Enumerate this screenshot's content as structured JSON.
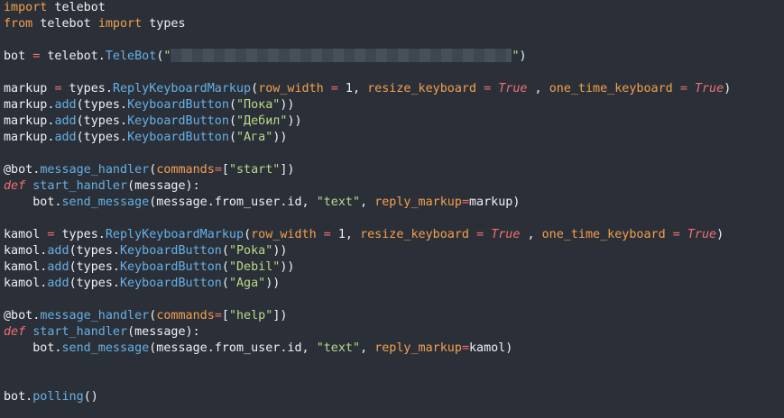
{
  "lines": [
    {
      "tokens": [
        {
          "t": "import",
          "c": "kw"
        },
        {
          "t": " telebot",
          "c": "mod"
        }
      ]
    },
    {
      "tokens": [
        {
          "t": "from",
          "c": "kw"
        },
        {
          "t": " telebot ",
          "c": "mod"
        },
        {
          "t": "import",
          "c": "kw"
        },
        {
          "t": " types",
          "c": "mod"
        }
      ]
    },
    {
      "tokens": []
    },
    {
      "tokens": [
        {
          "t": "bot ",
          "c": "mod"
        },
        {
          "t": "=",
          "c": "op"
        },
        {
          "t": " telebot.",
          "c": "mod"
        },
        {
          "t": "TeleBot",
          "c": "call"
        },
        {
          "t": "(",
          "c": "mod"
        },
        {
          "t": "\"",
          "c": "str"
        },
        {
          "t": "",
          "c": "redacted"
        },
        {
          "t": "\"",
          "c": "str"
        },
        {
          "t": ")",
          "c": "mod"
        }
      ]
    },
    {
      "tokens": []
    },
    {
      "tokens": [
        {
          "t": "markup ",
          "c": "mod"
        },
        {
          "t": "=",
          "c": "op"
        },
        {
          "t": " types.",
          "c": "mod"
        },
        {
          "t": "ReplyKeyboardMarkup",
          "c": "call"
        },
        {
          "t": "(",
          "c": "mod"
        },
        {
          "t": "row_width",
          "c": "param"
        },
        {
          "t": " ",
          "c": "mod"
        },
        {
          "t": "=",
          "c": "op"
        },
        {
          "t": " 1, ",
          "c": "mod"
        },
        {
          "t": "resize_keyboard",
          "c": "param"
        },
        {
          "t": " ",
          "c": "mod"
        },
        {
          "t": "=",
          "c": "op"
        },
        {
          "t": " ",
          "c": "mod"
        },
        {
          "t": "True",
          "c": "bool"
        },
        {
          "t": " , ",
          "c": "mod"
        },
        {
          "t": "one_time_keyboard",
          "c": "param"
        },
        {
          "t": " ",
          "c": "mod"
        },
        {
          "t": "=",
          "c": "op"
        },
        {
          "t": " ",
          "c": "mod"
        },
        {
          "t": "True",
          "c": "bool"
        },
        {
          "t": ")",
          "c": "mod"
        }
      ]
    },
    {
      "tokens": [
        {
          "t": "markup.",
          "c": "mod"
        },
        {
          "t": "add",
          "c": "call"
        },
        {
          "t": "(types.",
          "c": "mod"
        },
        {
          "t": "KeyboardButton",
          "c": "call"
        },
        {
          "t": "(",
          "c": "mod"
        },
        {
          "t": "\"Пока\"",
          "c": "str"
        },
        {
          "t": "))",
          "c": "mod"
        }
      ]
    },
    {
      "tokens": [
        {
          "t": "markup.",
          "c": "mod"
        },
        {
          "t": "add",
          "c": "call"
        },
        {
          "t": "(types.",
          "c": "mod"
        },
        {
          "t": "KeyboardButton",
          "c": "call"
        },
        {
          "t": "(",
          "c": "mod"
        },
        {
          "t": "\"Дебил\"",
          "c": "str"
        },
        {
          "t": "))",
          "c": "mod"
        }
      ]
    },
    {
      "tokens": [
        {
          "t": "markup.",
          "c": "mod"
        },
        {
          "t": "add",
          "c": "call"
        },
        {
          "t": "(types.",
          "c": "mod"
        },
        {
          "t": "KeyboardButton",
          "c": "call"
        },
        {
          "t": "(",
          "c": "mod"
        },
        {
          "t": "\"Ага\"",
          "c": "str"
        },
        {
          "t": "))",
          "c": "mod"
        }
      ]
    },
    {
      "tokens": []
    },
    {
      "tokens": [
        {
          "t": "@bot.",
          "c": "dec"
        },
        {
          "t": "message_handler",
          "c": "call"
        },
        {
          "t": "(",
          "c": "mod"
        },
        {
          "t": "commands",
          "c": "param"
        },
        {
          "t": "=",
          "c": "op"
        },
        {
          "t": "[",
          "c": "mod"
        },
        {
          "t": "\"start\"",
          "c": "str"
        },
        {
          "t": "])",
          "c": "mod"
        }
      ]
    },
    {
      "tokens": [
        {
          "t": "def",
          "c": "defkw"
        },
        {
          "t": " ",
          "c": "mod"
        },
        {
          "t": "start_handler",
          "c": "call"
        },
        {
          "t": "(message):",
          "c": "mod"
        }
      ]
    },
    {
      "tokens": [
        {
          "t": "    bot.",
          "c": "mod"
        },
        {
          "t": "send_message",
          "c": "call"
        },
        {
          "t": "(message.from_user.id, ",
          "c": "mod"
        },
        {
          "t": "\"text\"",
          "c": "str"
        },
        {
          "t": ", ",
          "c": "mod"
        },
        {
          "t": "reply_markup",
          "c": "param"
        },
        {
          "t": "=",
          "c": "op"
        },
        {
          "t": "markup)",
          "c": "mod"
        }
      ]
    },
    {
      "tokens": []
    },
    {
      "tokens": [
        {
          "t": "kamol ",
          "c": "mod"
        },
        {
          "t": "=",
          "c": "op"
        },
        {
          "t": " types.",
          "c": "mod"
        },
        {
          "t": "ReplyKeyboardMarkup",
          "c": "call"
        },
        {
          "t": "(",
          "c": "mod"
        },
        {
          "t": "row_width",
          "c": "param"
        },
        {
          "t": " ",
          "c": "mod"
        },
        {
          "t": "=",
          "c": "op"
        },
        {
          "t": " 1, ",
          "c": "mod"
        },
        {
          "t": "resize_keyboard",
          "c": "param"
        },
        {
          "t": " ",
          "c": "mod"
        },
        {
          "t": "=",
          "c": "op"
        },
        {
          "t": " ",
          "c": "mod"
        },
        {
          "t": "True",
          "c": "bool"
        },
        {
          "t": " , ",
          "c": "mod"
        },
        {
          "t": "one_time_keyboard",
          "c": "param"
        },
        {
          "t": " ",
          "c": "mod"
        },
        {
          "t": "=",
          "c": "op"
        },
        {
          "t": " ",
          "c": "mod"
        },
        {
          "t": "True",
          "c": "bool"
        },
        {
          "t": ")",
          "c": "mod"
        }
      ]
    },
    {
      "tokens": [
        {
          "t": "kamol.",
          "c": "mod"
        },
        {
          "t": "add",
          "c": "call"
        },
        {
          "t": "(types.",
          "c": "mod"
        },
        {
          "t": "KeyboardButton",
          "c": "call"
        },
        {
          "t": "(",
          "c": "mod"
        },
        {
          "t": "\"Poka\"",
          "c": "str"
        },
        {
          "t": "))",
          "c": "mod"
        }
      ]
    },
    {
      "tokens": [
        {
          "t": "kamol.",
          "c": "mod"
        },
        {
          "t": "add",
          "c": "call"
        },
        {
          "t": "(types.",
          "c": "mod"
        },
        {
          "t": "KeyboardButton",
          "c": "call"
        },
        {
          "t": "(",
          "c": "mod"
        },
        {
          "t": "\"Debil\"",
          "c": "str"
        },
        {
          "t": "))",
          "c": "mod"
        }
      ]
    },
    {
      "tokens": [
        {
          "t": "kamol.",
          "c": "mod"
        },
        {
          "t": "add",
          "c": "call"
        },
        {
          "t": "(types.",
          "c": "mod"
        },
        {
          "t": "KeyboardButton",
          "c": "call"
        },
        {
          "t": "(",
          "c": "mod"
        },
        {
          "t": "\"Aga\"",
          "c": "str"
        },
        {
          "t": "))",
          "c": "mod"
        }
      ]
    },
    {
      "tokens": []
    },
    {
      "tokens": [
        {
          "t": "@bot.",
          "c": "dec"
        },
        {
          "t": "message_handler",
          "c": "call"
        },
        {
          "t": "(",
          "c": "mod"
        },
        {
          "t": "commands",
          "c": "param"
        },
        {
          "t": "=",
          "c": "op"
        },
        {
          "t": "[",
          "c": "mod"
        },
        {
          "t": "\"help\"",
          "c": "str"
        },
        {
          "t": "])",
          "c": "mod"
        }
      ]
    },
    {
      "tokens": [
        {
          "t": "def",
          "c": "defkw"
        },
        {
          "t": " ",
          "c": "mod"
        },
        {
          "t": "start_handler",
          "c": "call"
        },
        {
          "t": "(message):",
          "c": "mod"
        }
      ]
    },
    {
      "tokens": [
        {
          "t": "    bot.",
          "c": "mod"
        },
        {
          "t": "send_message",
          "c": "call"
        },
        {
          "t": "(message.from_user.id, ",
          "c": "mod"
        },
        {
          "t": "\"text\"",
          "c": "str"
        },
        {
          "t": ", ",
          "c": "mod"
        },
        {
          "t": "reply_markup",
          "c": "param"
        },
        {
          "t": "=",
          "c": "op"
        },
        {
          "t": "kamol)",
          "c": "mod"
        }
      ]
    },
    {
      "tokens": []
    },
    {
      "tokens": []
    },
    {
      "tokens": [
        {
          "t": "bot.",
          "c": "mod"
        },
        {
          "t": "polling",
          "c": "call"
        },
        {
          "t": "()",
          "c": "mod"
        }
      ]
    }
  ],
  "colors": {
    "background": "#2b3038",
    "text": "#eef0f3",
    "keyword": "#f39f4d",
    "function": "#66b0e6",
    "string": "#b9d98b",
    "operator": "#ef6f72"
  }
}
